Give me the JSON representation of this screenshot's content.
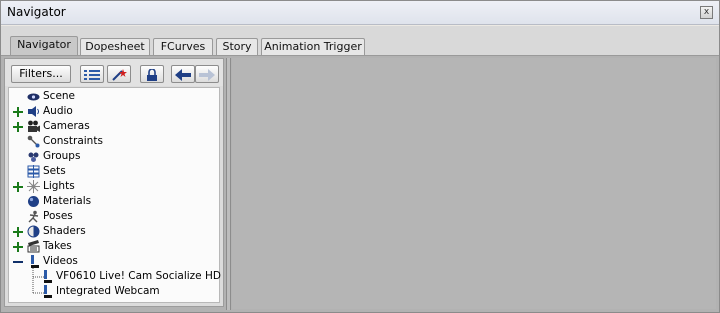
{
  "window": {
    "title": "Navigator",
    "close_glyph": "x"
  },
  "tabs": [
    {
      "label": "Navigator",
      "active": true
    },
    {
      "label": "Dopesheet"
    },
    {
      "label": "FCurves"
    },
    {
      "label": "Story"
    },
    {
      "label": "Animation Trigger"
    }
  ],
  "toolbar": {
    "filters_label": "Filters...",
    "buttons": [
      "list-icon",
      "magic-wand-icon",
      "lock-icon",
      "back-arrow-icon",
      "forward-arrow-icon"
    ]
  },
  "tree": {
    "items": [
      {
        "label": "Scene",
        "icon": "scene-eye-icon",
        "expander": ""
      },
      {
        "label": "Audio",
        "icon": "speaker-icon",
        "expander": "+"
      },
      {
        "label": "Cameras",
        "icon": "camera-icon",
        "expander": "+"
      },
      {
        "label": "Constraints",
        "icon": "constraint-icon",
        "expander": ""
      },
      {
        "label": "Groups",
        "icon": "group-icon",
        "expander": ""
      },
      {
        "label": "Sets",
        "icon": "sets-icon",
        "expander": ""
      },
      {
        "label": "Lights",
        "icon": "light-icon",
        "expander": "+"
      },
      {
        "label": "Materials",
        "icon": "material-sphere-icon",
        "expander": ""
      },
      {
        "label": "Poses",
        "icon": "pose-icon",
        "expander": ""
      },
      {
        "label": "Shaders",
        "icon": "shader-icon",
        "expander": "+"
      },
      {
        "label": "Takes",
        "icon": "clapper-icon",
        "expander": "+"
      },
      {
        "label": "Videos",
        "icon": "video-icon",
        "expander": "-"
      },
      {
        "label": "VF0610 Live! Cam Socialize HD",
        "icon": "video-clip-icon",
        "expander": "",
        "child": true
      },
      {
        "label": "Integrated Webcam",
        "icon": "video-clip-icon",
        "expander": "",
        "child": true
      }
    ]
  },
  "colors": {
    "expander_plus": "#1a7a1a",
    "expander_minus": "#10306a"
  }
}
